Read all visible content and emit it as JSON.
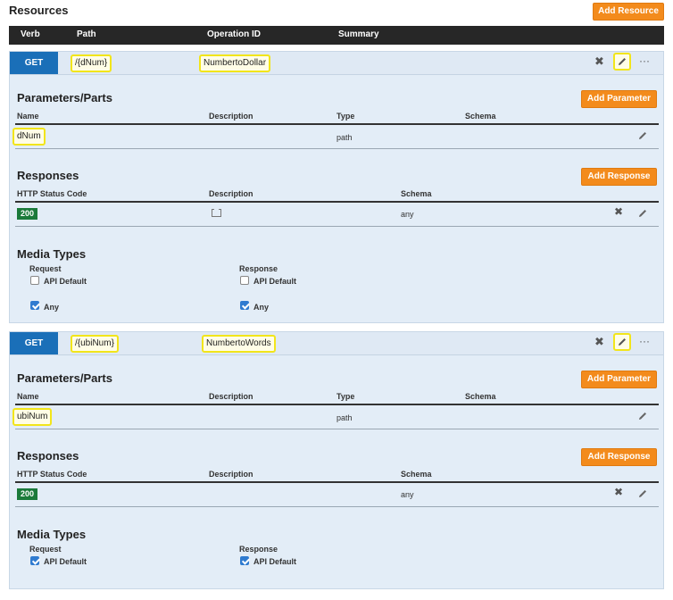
{
  "page": {
    "title": "Resources",
    "add_resource_label": "Add Resource"
  },
  "table_header": {
    "verb": "Verb",
    "path": "Path",
    "operation_id": "Operation ID",
    "summary": "Summary"
  },
  "resources": [
    {
      "verb": "GET",
      "path": "/{dNum}",
      "operation_id": "NumbertoDollar",
      "parameters": {
        "title": "Parameters/Parts",
        "add_label": "Add Parameter",
        "columns": [
          "Name",
          "Description",
          "Type",
          "Schema"
        ],
        "rows": [
          {
            "name": "dNum",
            "description": "",
            "type": "path",
            "schema": ""
          }
        ]
      },
      "responses": {
        "title": "Responses",
        "add_label": "Add Response",
        "columns": [
          "HTTP Status Code",
          "Description",
          "Schema"
        ],
        "rows": [
          {
            "code": "200",
            "schema": "any"
          }
        ]
      },
      "media_types": {
        "title": "Media Types",
        "request_label": "Request",
        "response_label": "Response",
        "request_options": [
          {
            "label": "API Default",
            "checked": false
          },
          {
            "label": "Any",
            "checked": true
          }
        ],
        "response_options": [
          {
            "label": "API Default",
            "checked": false
          },
          {
            "label": "Any",
            "checked": true
          }
        ]
      }
    },
    {
      "verb": "GET",
      "path": "/{ubiNum}",
      "operation_id": "NumbertoWords",
      "parameters": {
        "title": "Parameters/Parts",
        "add_label": "Add Parameter",
        "columns": [
          "Name",
          "Description",
          "Type",
          "Schema"
        ],
        "rows": [
          {
            "name": "ubiNum",
            "description": "",
            "type": "path",
            "schema": ""
          }
        ]
      },
      "responses": {
        "title": "Responses",
        "add_label": "Add Response",
        "columns": [
          "HTTP Status Code",
          "Description",
          "Schema"
        ],
        "rows": [
          {
            "code": "200",
            "schema": "any"
          }
        ]
      },
      "media_types": {
        "title": "Media Types",
        "request_label": "Request",
        "response_label": "Response",
        "request_options": [
          {
            "label": "API Default",
            "checked": true
          }
        ],
        "response_options": [
          {
            "label": "API Default",
            "checked": true
          }
        ]
      }
    }
  ],
  "icons": {
    "delete": "close-icon",
    "edit": "pencil-icon",
    "more": "more-icon",
    "description": "description-icon"
  },
  "colors": {
    "accent": "#f38b1c",
    "verb": "#1a6fb8",
    "status_ok": "#1b7a3a",
    "panel": "#e3edf7",
    "highlight": "#f2e51a"
  }
}
